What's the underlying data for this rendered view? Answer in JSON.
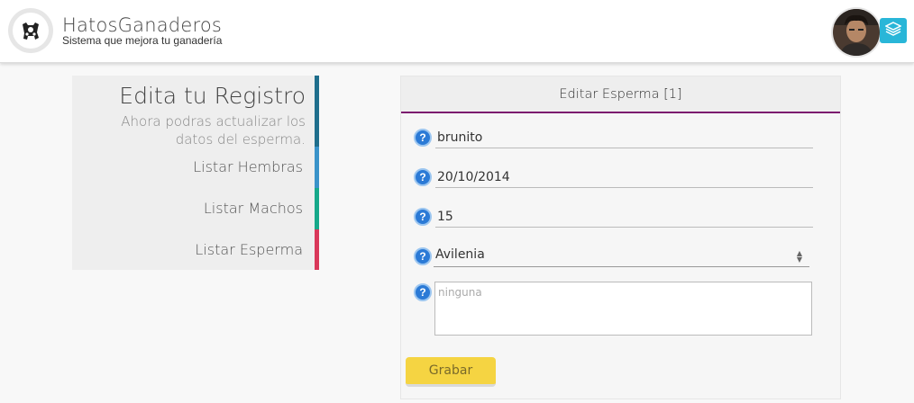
{
  "header": {
    "app_title": "HatosGanaderos",
    "app_subtitle": "Sistema que mejora tu ganadería",
    "logo_icon": "cow-icon",
    "layers_icon": "layers-icon",
    "accent_color": "#29b6d8"
  },
  "sidebar": {
    "title": "Edita tu Registro",
    "description": "Ahora podras actualizar los datos del esperma.",
    "links": [
      {
        "label": "Listar Hembras",
        "color": "#3a93c9"
      },
      {
        "label": "Listar Machos",
        "color": "#16a98a"
      },
      {
        "label": "Listar Esperma",
        "color": "#d9385a"
      }
    ],
    "title_color": "#1f6e8c"
  },
  "form": {
    "title": "Editar Esperma [1]",
    "accent_color": "#7b1a6e",
    "fields": {
      "name": "brunito",
      "date": "20/10/2014",
      "quantity": "15",
      "breed": "Avilenia",
      "notes_placeholder": "ninguna"
    },
    "help_icon": "help-icon",
    "submit_label": "Grabar",
    "submit_color": "#f5d442"
  }
}
